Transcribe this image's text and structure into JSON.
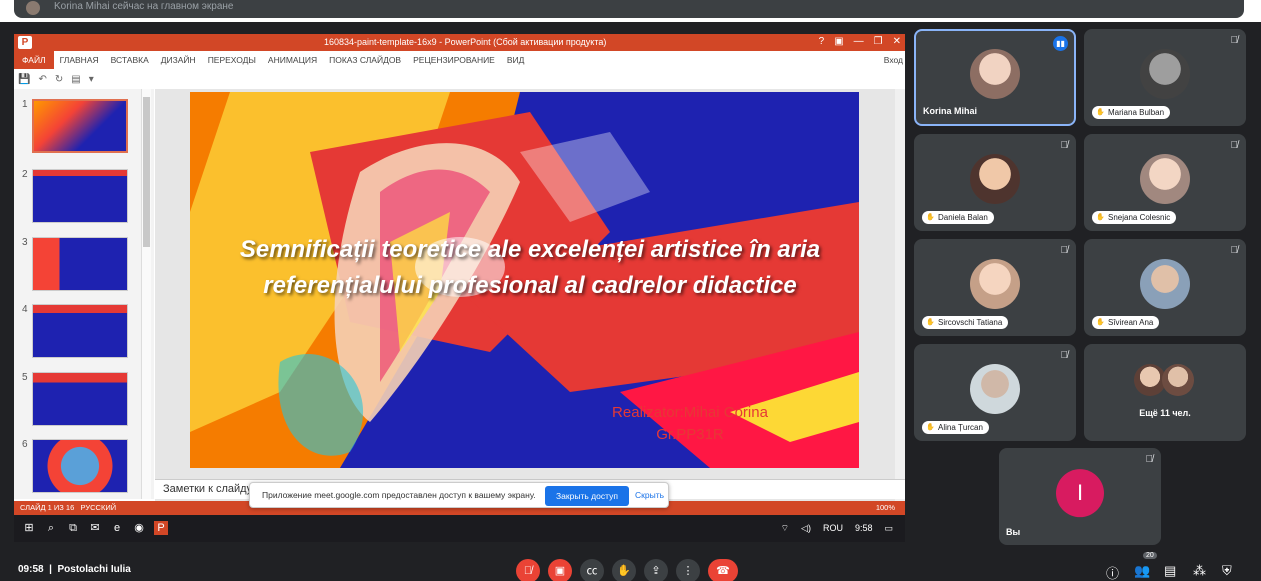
{
  "top_banner": {
    "text": "Korina Mihai сейчас на главном экране"
  },
  "powerpoint": {
    "window_title": "160834-paint-template-16x9 - PowerPoint (Сбой активации продукта)",
    "ribbon_tabs": [
      "ФАЙЛ",
      "ГЛАВНАЯ",
      "ВСТАВКА",
      "ДИЗАЙН",
      "ПЕРЕХОДЫ",
      "АНИМАЦИЯ",
      "ПОКАЗ СЛАЙДОВ",
      "РЕЦЕНЗИРОВАНИЕ",
      "ВИД"
    ],
    "signin": "Вход",
    "thumbnails": [
      "1",
      "2",
      "3",
      "4",
      "5",
      "6"
    ],
    "slide": {
      "title": "Semnificații teoretice ale excelenței artistice în aria referențialului profesional al cadrelor didactice",
      "author_line1": "Realizator:Mihai Corina",
      "author_line2": "Gr.PP31R"
    },
    "notes_placeholder": "Заметки к слайду",
    "status_left": "СЛАЙД 1 ИЗ 16",
    "status_lang": "РУССКИЙ",
    "zoom": "100%"
  },
  "taskbar": {
    "lang": "ROU",
    "time": "9:58"
  },
  "share_bar": {
    "message": "Приложение meet.google.com предоставлен доступ к вашему экрану.",
    "share_button": "Закрыть доступ",
    "hide_button": "Скрыть"
  },
  "participants": [
    {
      "name": "Korina Mihai",
      "speaking": true
    },
    {
      "name": "Mariana Bulban"
    },
    {
      "name": "Daniela Balan"
    },
    {
      "name": "Snejana Colesnic"
    },
    {
      "name": "Sircovschi Tatiana"
    },
    {
      "name": "Sîvirean Ana"
    },
    {
      "name": "Alina Țurcan"
    },
    {
      "name": "Ещё 11 чел."
    },
    {
      "name": "Вы",
      "initial": "I"
    }
  ],
  "bottom_bar": {
    "time": "09:58",
    "meeting_name": "Postolachi Iulia",
    "participant_count": "20"
  },
  "colors": {
    "meet_bg": "#202124",
    "tile_bg": "#3c4043",
    "ppt_accent": "#d24726",
    "end_call": "#ea4335",
    "self_avatar": "#d81b60"
  }
}
